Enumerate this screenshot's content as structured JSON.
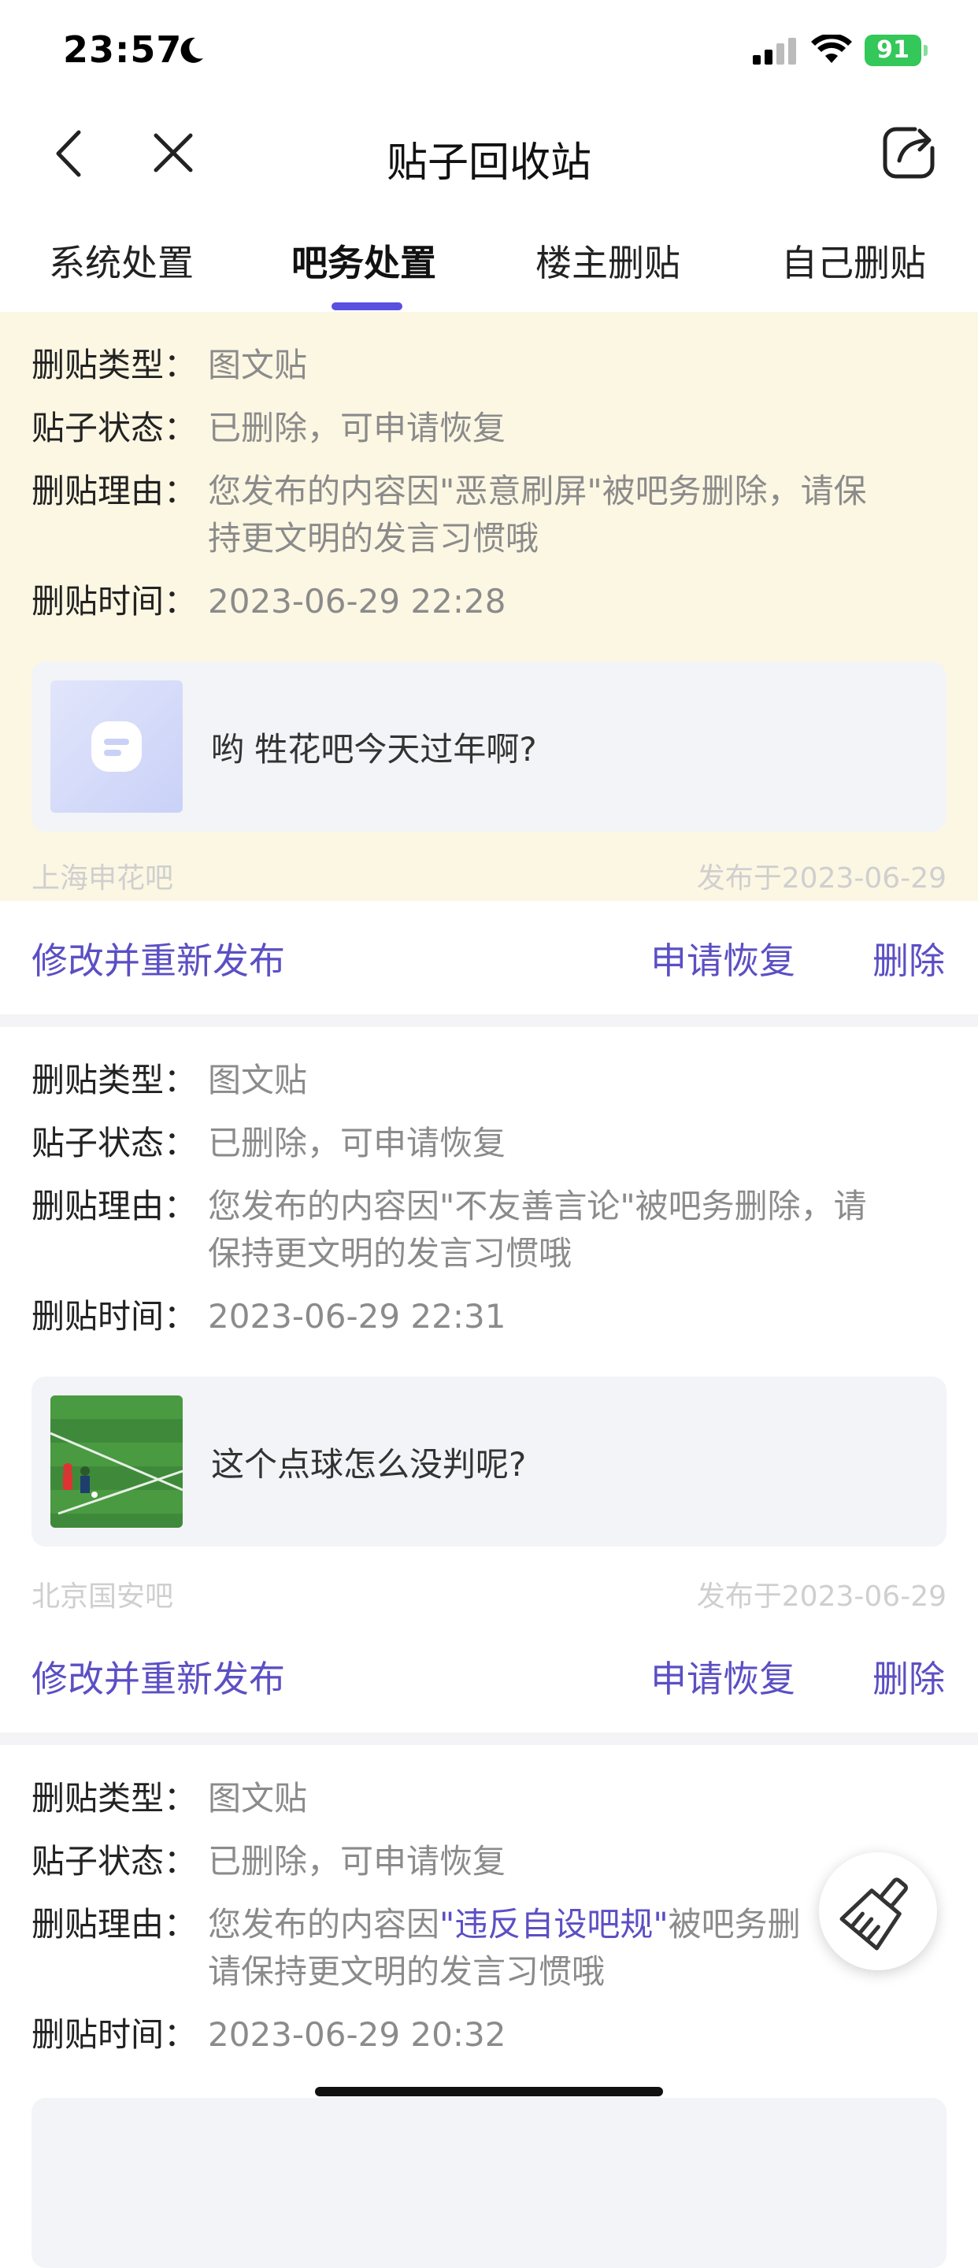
{
  "status": {
    "time": "23:57",
    "battery": "91"
  },
  "nav": {
    "title": "贴子回收站"
  },
  "tabs": [
    "系统处置",
    "吧务处置",
    "楼主删贴",
    "自己删贴"
  ],
  "labels": {
    "type": "删贴类型：",
    "status": "贴子状态：",
    "reason": "删贴理由：",
    "time": "删贴时间："
  },
  "cards": [
    {
      "type": "图文贴",
      "status": "已删除，可申请恢复",
      "reason_line1": "您发布的内容因\"恶意刷屏\"被吧务删除，请保",
      "reason_line2": "持更文明的发言习惯哦",
      "time": "2023-06-29 22:28",
      "post_title": "哟 牲花吧今天过年啊?",
      "bar": "上海申花吧",
      "published": "发布于2023-06-29",
      "action_edit": "修改并重新发布",
      "action_restore": "申请恢复",
      "action_delete": "删除"
    },
    {
      "type": "图文贴",
      "status": "已删除，可申请恢复",
      "reason_line1": "您发布的内容因\"不友善言论\"被吧务删除，请",
      "reason_line2": "保持更文明的发言习惯哦",
      "time": "2023-06-29 22:31",
      "post_title": "这个点球怎么没判呢?",
      "bar": "北京国安吧",
      "published": "发布于2023-06-29",
      "action_edit": "修改并重新发布",
      "action_restore": "申请恢复",
      "action_delete": "删除"
    },
    {
      "type": "图文贴",
      "status": "已删除，可申请恢复",
      "reason_prefix": "您发布的内容因",
      "reason_highlight": "\"违反自设吧规\"",
      "reason_suffix": "被吧务删",
      "reason_line2": "请保持更文明的发言习惯哦",
      "time": "2023-06-29 20:32"
    }
  ],
  "colors": {
    "accent": "#5b4fc4",
    "highlight_bg": "#fcf7e3"
  }
}
